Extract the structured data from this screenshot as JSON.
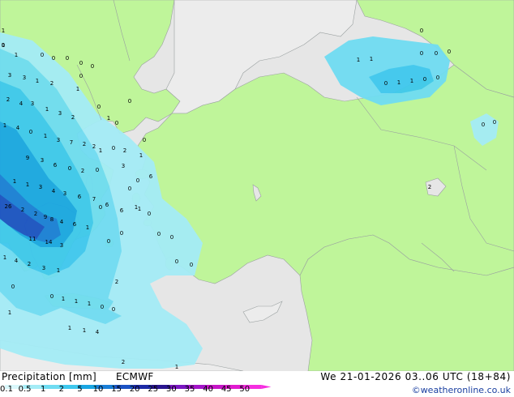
{
  "title": "Precipitation [mm]",
  "model": "ECMWF",
  "valid_time": "We 21-01-2026 03..06 UTC (18+84)",
  "credit": "©weatheronline.co.uk",
  "colors": {
    "sea": "#e6e6e6",
    "land": "#bff59a",
    "land_other": "#ececec",
    "border": "#9aa0a0"
  },
  "scale": {
    "ticks": [
      "0.1",
      "0.5",
      "1",
      "2",
      "5",
      "10",
      "15",
      "20",
      "25",
      "30",
      "35",
      "40",
      "45",
      "50"
    ],
    "colors": [
      "#d8f7fb",
      "#a4ecf6",
      "#6fdcf2",
      "#3ec8ee",
      "#1aa6e3",
      "#1a7fd8",
      "#1b52c4",
      "#1d2aa6",
      "#2a1590",
      "#7b16c2",
      "#a414c9",
      "#c615c7",
      "#e11bd0",
      "#f52fe0"
    ]
  },
  "precip_labels": [
    "1",
    "1",
    "0",
    "0",
    "0",
    "0",
    "3",
    "3",
    "1",
    "2",
    "1",
    "2",
    "4",
    "3",
    "1",
    "3",
    "2",
    "1",
    "4",
    "0",
    "1",
    "3",
    "7",
    "2",
    "2",
    "1",
    "0",
    "2",
    "1",
    "9",
    "3",
    "6",
    "0",
    "2",
    "0",
    "1",
    "1",
    "3",
    "4",
    "3",
    "6",
    "7",
    "6",
    "6",
    "1",
    "26",
    "2",
    "2",
    "9",
    "8",
    "4",
    "6",
    "1",
    "11",
    "14",
    "3",
    "1",
    "4",
    "2",
    "3",
    "1",
    "2",
    "0",
    "0",
    "1",
    "1",
    "1",
    "0",
    "0",
    "1",
    "1",
    "1",
    "4",
    "2",
    "1",
    "0",
    "0",
    "0",
    "0",
    "0",
    "0",
    "1",
    "0",
    "1",
    "1",
    "0",
    "1",
    "1",
    "0",
    "0",
    "0",
    "0",
    "0",
    "0",
    "0",
    "0",
    "2",
    "0",
    "0",
    "0",
    "6",
    "3",
    "0",
    "0",
    "0",
    "1",
    "1",
    "0",
    "0",
    "0",
    "0"
  ]
}
